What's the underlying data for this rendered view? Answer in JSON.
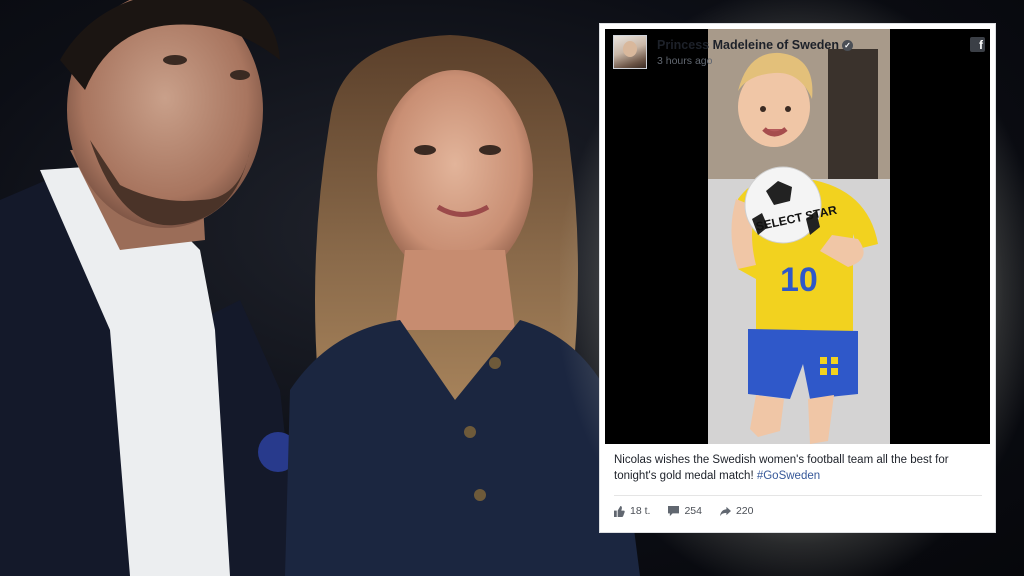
{
  "post": {
    "page_name": "Princess Madeleine of Sweden",
    "verified_icon": "verified-checkmark-icon",
    "timestamp": "3 hours ago",
    "platform_icon": "facebook-icon",
    "video": {
      "jersey_number": "10",
      "ball_text": "SELECT STAR"
    },
    "caption": {
      "text": "Nicolas wishes the Swedish women's football team all the best for tonight's gold medal match! ",
      "hashtag": "#GoSweden"
    },
    "stats": {
      "likes": "18 t.",
      "comments": "254",
      "shares": "220"
    }
  },
  "colors": {
    "link_blue": "#365899",
    "jersey_yellow": "#f2d21f",
    "shorts_blue": "#2f58c9"
  }
}
